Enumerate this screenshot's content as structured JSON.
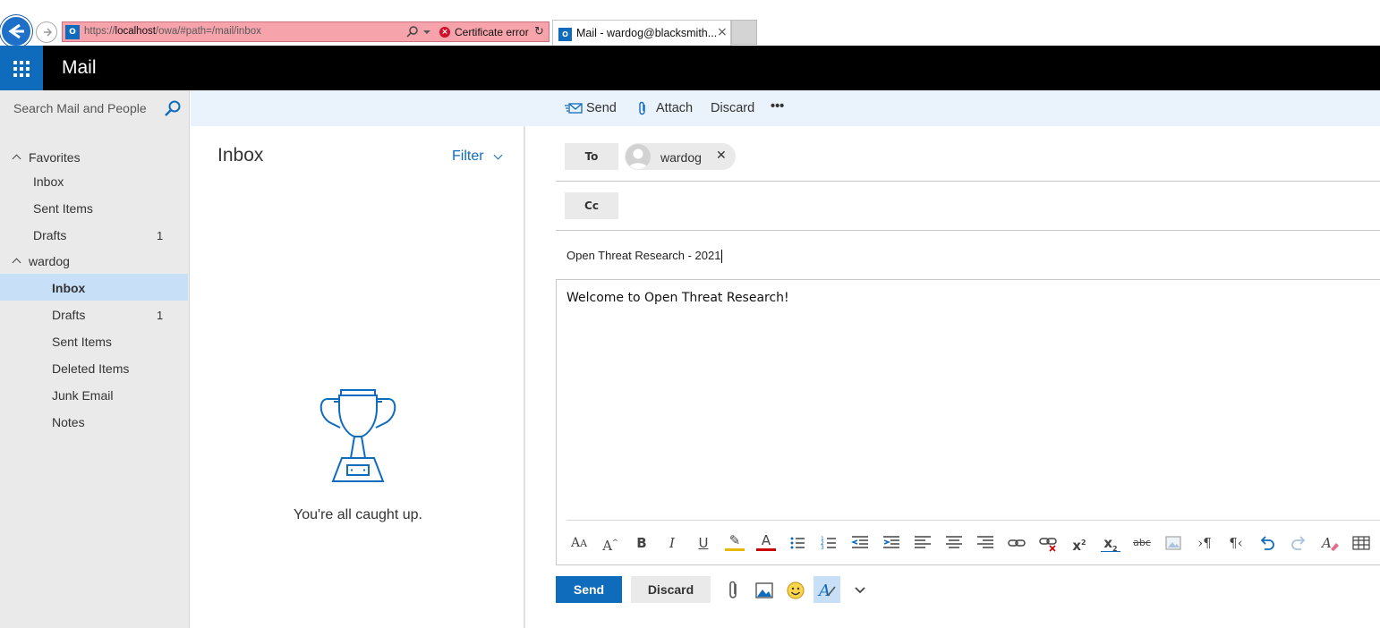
{
  "browser": {
    "url_scheme": "https://",
    "url_host": "localhost",
    "url_path": "/owa/#path=/mail/inbox",
    "cert_label": "Certificate error",
    "tab_title": "Mail - wardog@blacksmith...."
  },
  "app": {
    "title": "Mail",
    "brand_color": "#0f6cbd"
  },
  "sidebar": {
    "search_placeholder": "Search Mail and People",
    "favorites_label": "Favorites",
    "favorites": [
      {
        "label": "Inbox",
        "count": ""
      },
      {
        "label": "Sent Items",
        "count": ""
      },
      {
        "label": "Drafts",
        "count": "1"
      }
    ],
    "account_label": "wardog",
    "folders": [
      {
        "label": "Inbox",
        "count": "",
        "selected": true
      },
      {
        "label": "Drafts",
        "count": "1"
      },
      {
        "label": "Sent Items",
        "count": ""
      },
      {
        "label": "Deleted Items",
        "count": ""
      },
      {
        "label": "Junk Email",
        "count": ""
      },
      {
        "label": "Notes",
        "count": ""
      }
    ]
  },
  "message_list": {
    "title": "Inbox",
    "filter_label": "Filter",
    "empty_message": "You're all caught up."
  },
  "toolbar": {
    "send_label": "Send",
    "attach_label": "Attach",
    "discard_label": "Discard",
    "more_label": "•••"
  },
  "compose": {
    "to_label": "To",
    "cc_label": "Cc",
    "recipients": [
      {
        "name": "wardog"
      }
    ],
    "subject": "Open Threat Research - 2021",
    "body": "Welcome to Open Threat Research!",
    "send_label": "Send",
    "discard_label": "Discard",
    "format_icons": [
      "font-size-icon",
      "grow-font-icon",
      "bold-icon",
      "italic-icon",
      "underline-icon",
      "highlight-icon",
      "font-color-icon",
      "bullets-icon",
      "numbering-icon",
      "decrease-indent-icon",
      "increase-indent-icon",
      "align-left-icon",
      "align-center-icon",
      "align-right-icon",
      "insert-link-icon",
      "remove-link-icon",
      "superscript-icon",
      "subscript-icon",
      "strikethrough-icon",
      "insert-picture-icon",
      "ltr-icon",
      "rtl-icon",
      "undo-icon",
      "redo-icon",
      "clear-format-icon",
      "insert-table-icon"
    ]
  }
}
